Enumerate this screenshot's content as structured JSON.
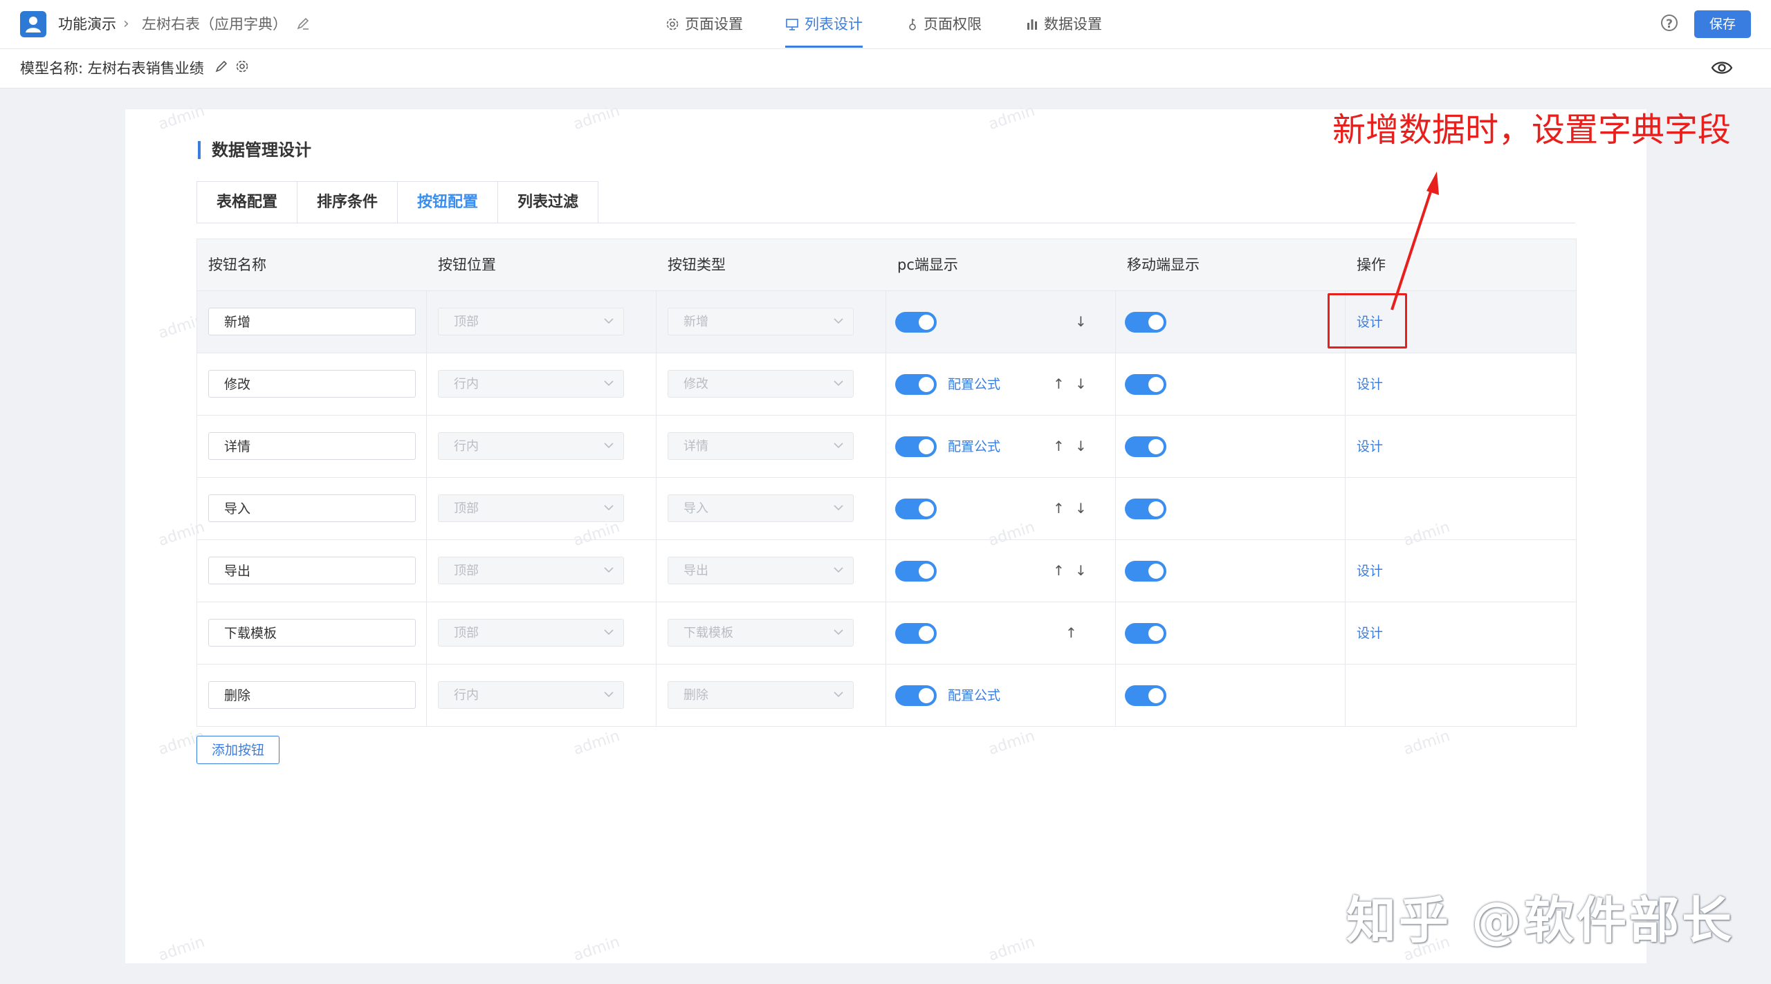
{
  "header": {
    "app_name": "功能演示",
    "page_name": "左树右表（应用字典）",
    "nav_tabs": [
      {
        "label": "页面设置",
        "icon": "gear-icon"
      },
      {
        "label": "列表设计",
        "icon": "list-design-icon"
      },
      {
        "label": "页面权限",
        "icon": "key-icon"
      },
      {
        "label": "数据设置",
        "icon": "bar-chart-icon"
      }
    ],
    "active_tab": "列表设计",
    "save_label": "保存"
  },
  "model": {
    "label": "模型名称:",
    "name": "左树右表销售业绩"
  },
  "section": {
    "title": "数据管理设计",
    "subtabs": [
      "表格配置",
      "排序条件",
      "按钮配置",
      "列表过滤"
    ],
    "active_subtab": "按钮配置"
  },
  "table": {
    "headers": [
      "按钮名称",
      "按钮位置",
      "按钮类型",
      "pc端显示",
      "移动端显示",
      "操作"
    ],
    "rows": [
      {
        "name": "新增",
        "position": "顶部",
        "type": "新增",
        "pc_on": true,
        "formula": "",
        "up": false,
        "down": true,
        "mobile_on": true,
        "action": "设计"
      },
      {
        "name": "修改",
        "position": "行内",
        "type": "修改",
        "pc_on": true,
        "formula": "配置公式",
        "up": true,
        "down": true,
        "mobile_on": true,
        "action": "设计"
      },
      {
        "name": "详情",
        "position": "行内",
        "type": "详情",
        "pc_on": true,
        "formula": "配置公式",
        "up": true,
        "down": true,
        "mobile_on": true,
        "action": "设计"
      },
      {
        "name": "导入",
        "position": "顶部",
        "type": "导入",
        "pc_on": true,
        "formula": "",
        "up": true,
        "down": true,
        "mobile_on": true,
        "action": ""
      },
      {
        "name": "导出",
        "position": "顶部",
        "type": "导出",
        "pc_on": true,
        "formula": "",
        "up": true,
        "down": true,
        "mobile_on": true,
        "action": "设计"
      },
      {
        "name": "下载模板",
        "position": "顶部",
        "type": "下载模板",
        "pc_on": true,
        "formula": "",
        "up": true,
        "down": false,
        "mobile_on": true,
        "action": "设计"
      },
      {
        "name": "删除",
        "position": "行内",
        "type": "删除",
        "pc_on": true,
        "formula": "配置公式",
        "up": false,
        "down": false,
        "mobile_on": true,
        "action": ""
      }
    ],
    "add_button_label": "添加按钮"
  },
  "annotation": {
    "text": "新增数据时，设置字典字段",
    "color": "#e8201d"
  },
  "watermark": {
    "text": "admin",
    "credit": "知乎 @软件部长"
  },
  "colors": {
    "accent": "#3a7de0",
    "switch_on": "#3a8ef0",
    "background": "#eff1f5"
  }
}
